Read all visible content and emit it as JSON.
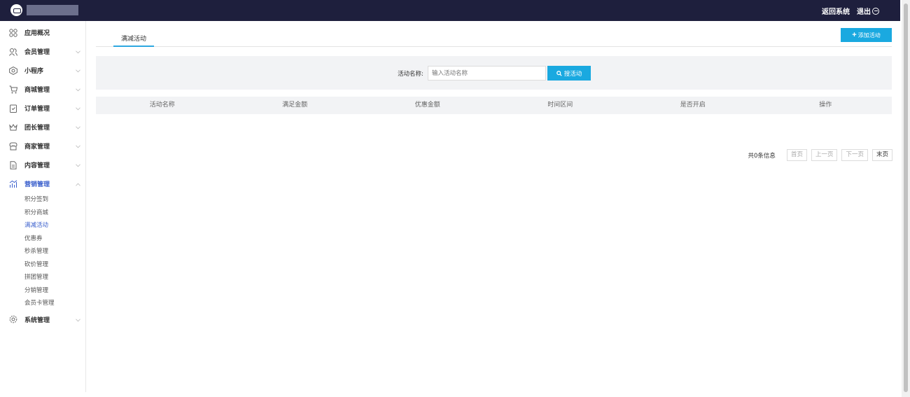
{
  "topbar": {
    "app_name": "",
    "back_label": "返回系统",
    "logout_label": "退出"
  },
  "sidebar": {
    "items": [
      {
        "label": "应用概况",
        "icon": "grid-icon",
        "has_arrow": false
      },
      {
        "label": "会员管理",
        "icon": "users-icon",
        "has_arrow": true
      },
      {
        "label": "小程序",
        "icon": "miniapp-icon",
        "has_arrow": true
      },
      {
        "label": "商城管理",
        "icon": "cart-icon",
        "has_arrow": true
      },
      {
        "label": "订单管理",
        "icon": "order-icon",
        "has_arrow": true
      },
      {
        "label": "团长管理",
        "icon": "crown-icon",
        "has_arrow": true
      },
      {
        "label": "商家管理",
        "icon": "store-icon",
        "has_arrow": true
      },
      {
        "label": "内容管理",
        "icon": "document-icon",
        "has_arrow": true
      },
      {
        "label": "营销管理",
        "icon": "chart-icon",
        "has_arrow": true,
        "expanded": true
      },
      {
        "label": "系统管理",
        "icon": "settings-icon",
        "has_arrow": true
      }
    ],
    "submenu": [
      "积分签到",
      "积分商城",
      "满减活动",
      "优惠券",
      "秒杀管理",
      "砍价管理",
      "拼团管理",
      "分销管理",
      "会员卡管理"
    ],
    "active_sub": "满减活动"
  },
  "tabs": {
    "active": "满减活动"
  },
  "toolbar": {
    "add_label": "添加活动",
    "add_plus": "+"
  },
  "search": {
    "label": "活动名称:",
    "placeholder": "输入活动名称",
    "button_label": "搜活动"
  },
  "table": {
    "columns": [
      "活动名称",
      "满足金额",
      "优惠金额",
      "时间区间",
      "是否开启",
      "操作"
    ]
  },
  "pager": {
    "total": "共0条信息",
    "first": "首页",
    "prev": "上一页",
    "next": "下一页",
    "last": "末页"
  },
  "colors": {
    "topbar": "#1e1f3d",
    "accent": "#1aa9e0",
    "active_text": "#3a5fcc"
  }
}
